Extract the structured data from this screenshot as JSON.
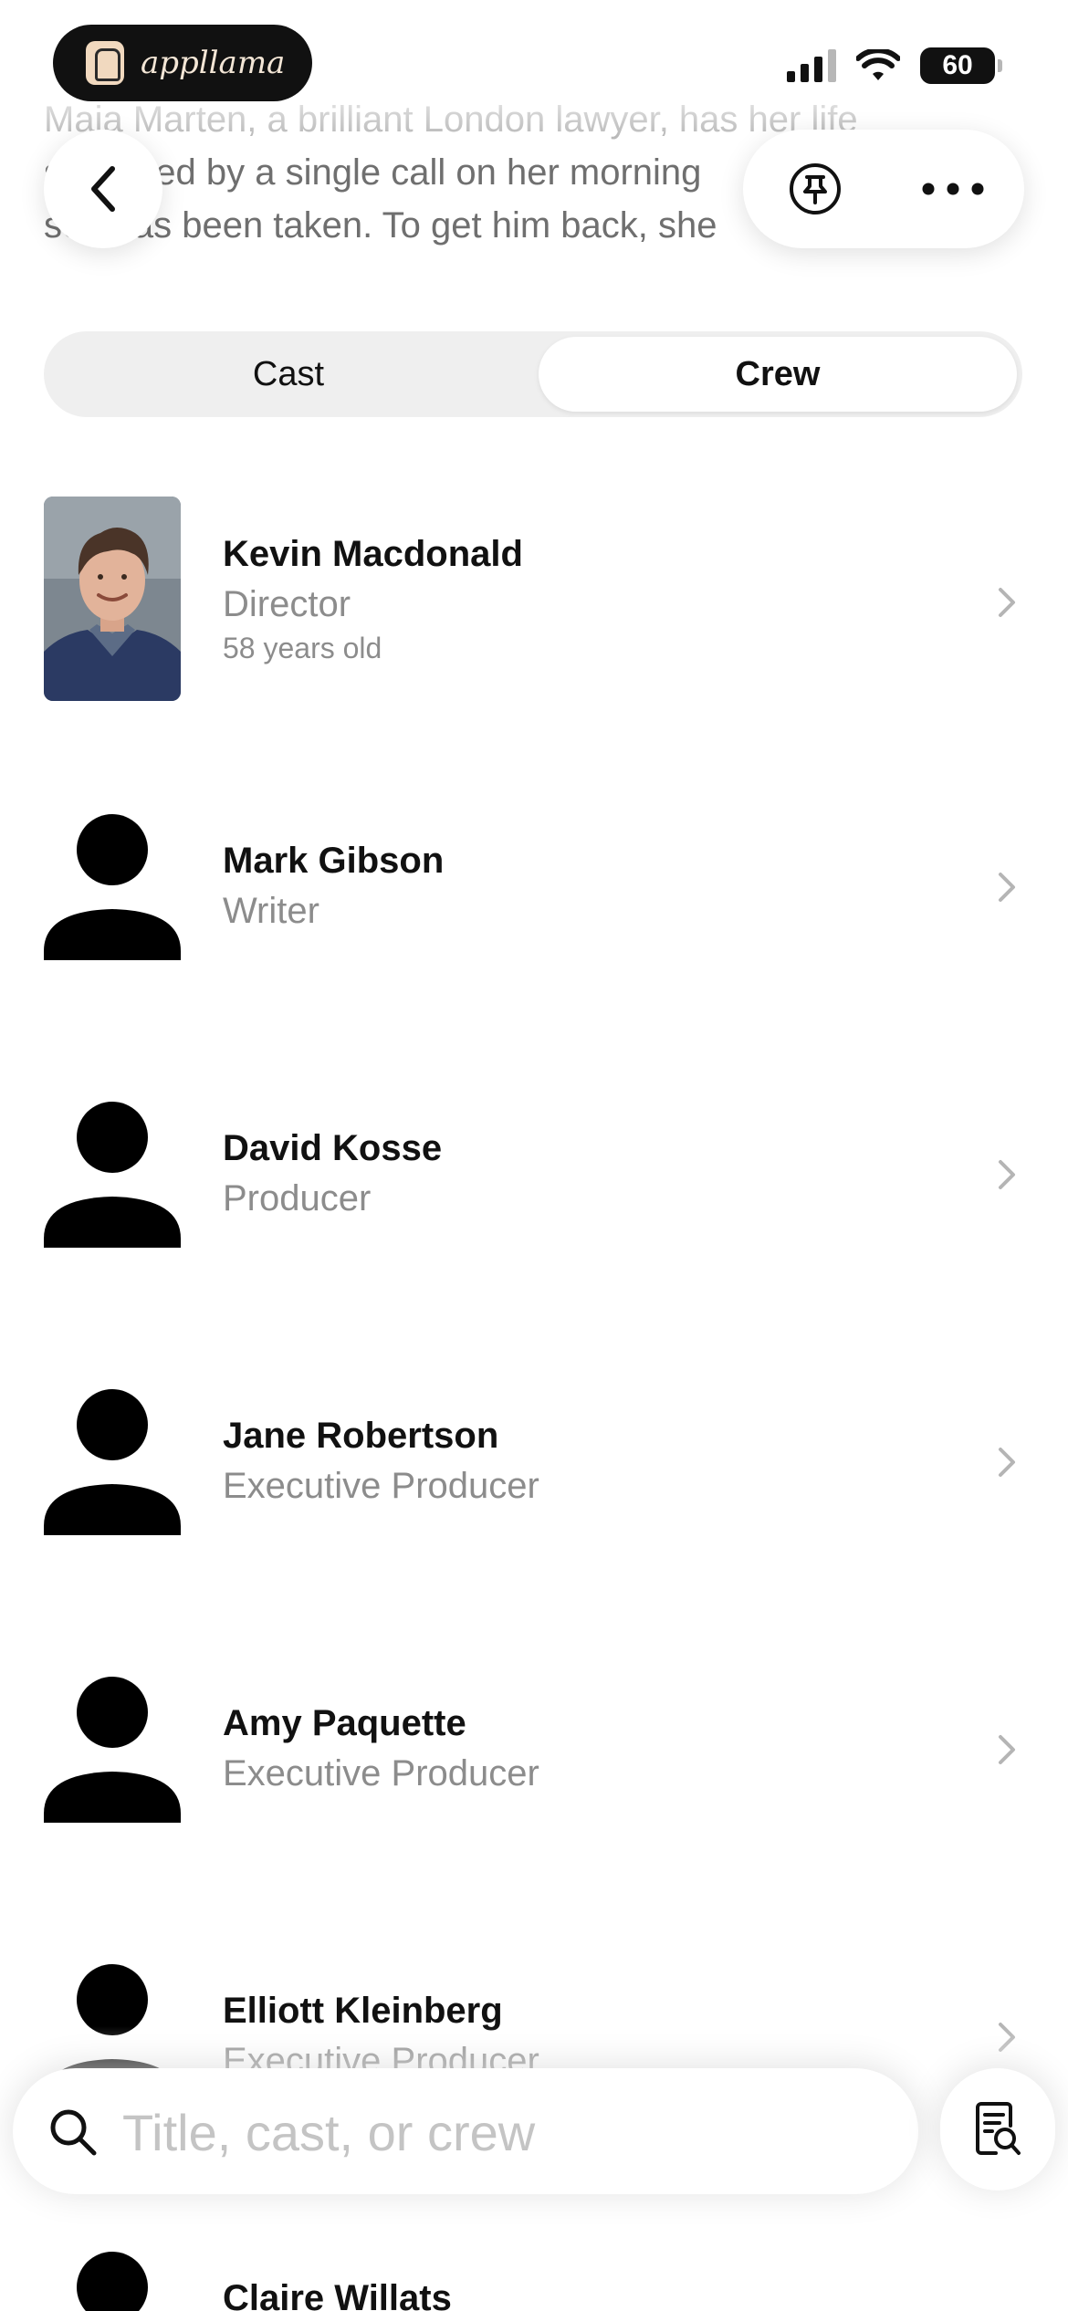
{
  "status_bar": {
    "app_brand": "appllama",
    "battery": "60"
  },
  "synopsis": {
    "line1": "Maja Marten, a brilliant London lawyer, has her life",
    "line2": "shattered by a single call on her morning",
    "line3": "son has been taken. To get him back, she"
  },
  "tabs": {
    "cast": "Cast",
    "crew": "Crew",
    "selected": "Crew"
  },
  "crew": [
    {
      "name": "Kevin Macdonald",
      "role": "Director",
      "age": "58 years old",
      "has_photo": true
    },
    {
      "name": "Mark Gibson",
      "role": "Writer"
    },
    {
      "name": "David Kosse",
      "role": "Producer"
    },
    {
      "name": "Jane Robertson",
      "role": "Executive Producer"
    },
    {
      "name": "Amy Paquette",
      "role": "Executive Producer"
    },
    {
      "name": "Elliott Kleinberg",
      "role": "Executive Producer"
    },
    {
      "name": "Claire Willats",
      "role": ""
    }
  ],
  "search": {
    "placeholder": "Title, cast, or crew"
  },
  "icons": {
    "back": "chevron-left-icon",
    "pin": "pin-icon",
    "more": "more-icon",
    "chevron": "chevron-right-icon",
    "search": "search-icon",
    "lookup": "document-search-icon"
  }
}
